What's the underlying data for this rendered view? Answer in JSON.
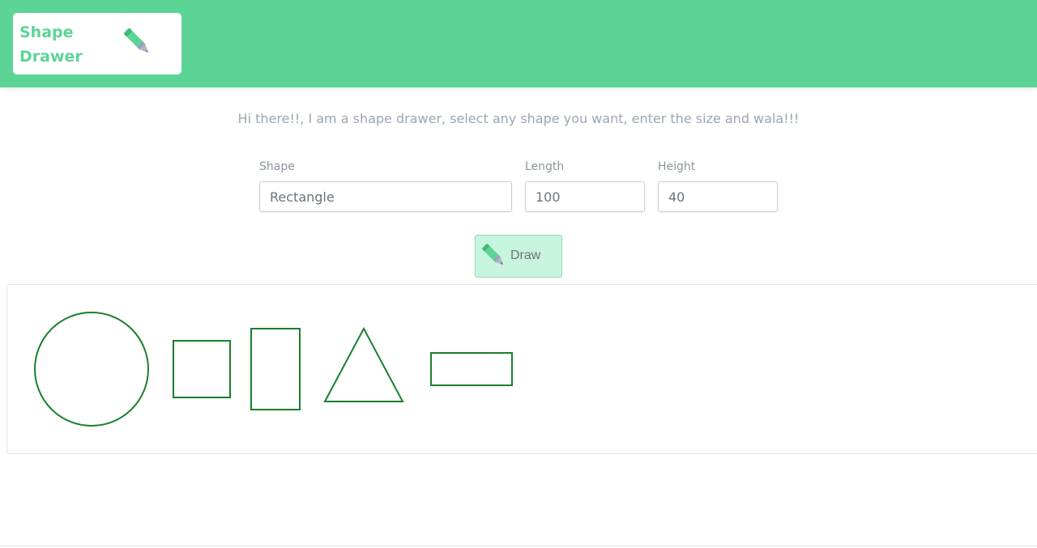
{
  "header": {
    "title_line1": "Shape",
    "title_line2": "Drawer",
    "logo_icon": "pencil-icon",
    "background_color": "#5cd496"
  },
  "intro_text": "Hi there!!, I am a shape drawer, select any shape you want, enter the size and wala!!!",
  "form": {
    "shape": {
      "label": "Shape",
      "value": "Rectangle"
    },
    "length": {
      "label": "Length",
      "value": "100"
    },
    "height": {
      "label": "Height",
      "value": "40"
    },
    "draw_button": {
      "label": "Draw",
      "icon": "pencil-icon"
    }
  },
  "drawn_shapes": [
    {
      "type": "circle"
    },
    {
      "type": "square"
    },
    {
      "type": "rectangle"
    },
    {
      "type": "triangle"
    },
    {
      "type": "rectangle"
    }
  ],
  "shape_stroke_color": "#1a7f2e"
}
